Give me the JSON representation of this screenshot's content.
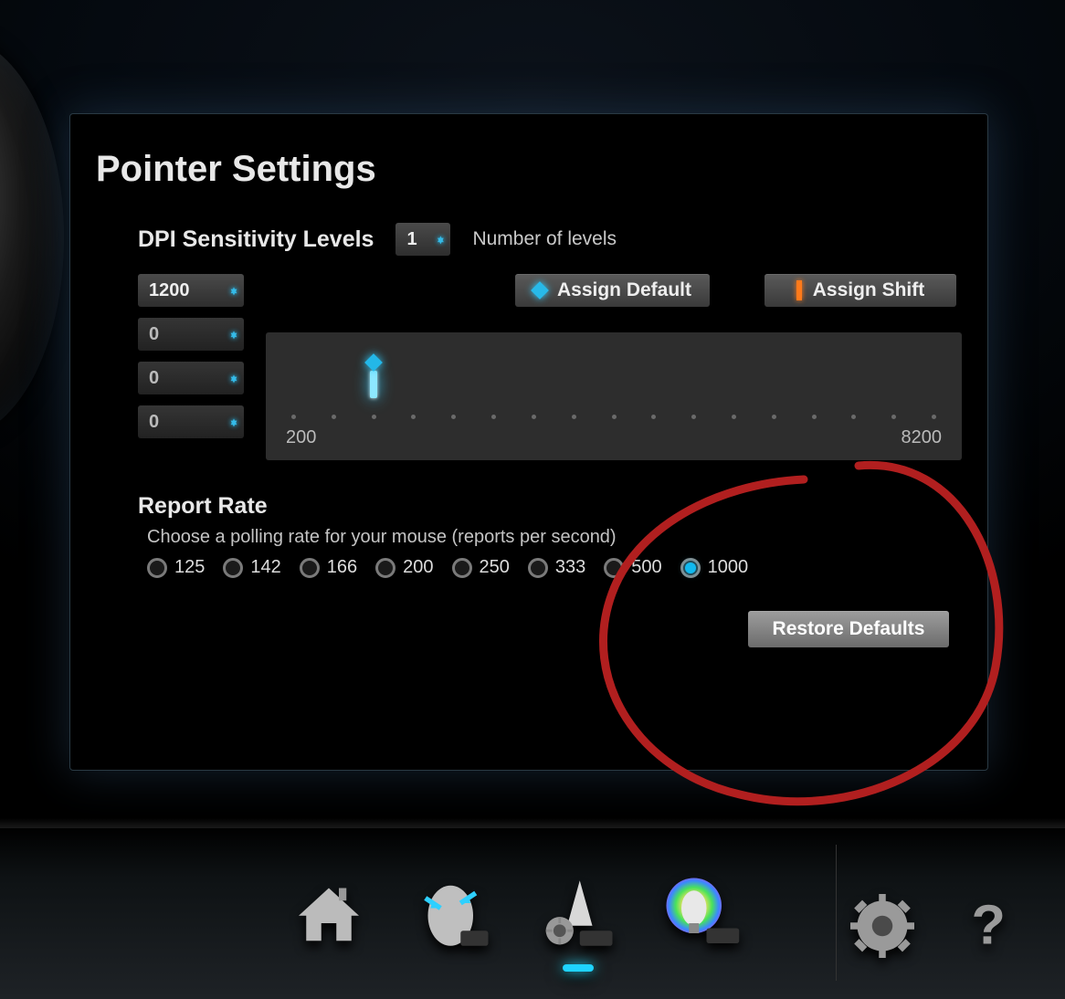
{
  "panel": {
    "title": "Pointer Settings",
    "dpi_label": "DPI Sensitivity Levels",
    "levels_stepper_value": "1",
    "levels_caption": "Number of levels",
    "assign_default_label": "Assign Default",
    "assign_shift_label": "Assign Shift",
    "dpi_values": [
      "1200",
      "0",
      "0",
      "0"
    ],
    "slider": {
      "min": "200",
      "max": "8200",
      "current": "1200"
    },
    "report_title": "Report Rate",
    "report_sub": "Choose a polling rate for your mouse (reports per second)",
    "report_options": [
      "125",
      "142",
      "166",
      "200",
      "250",
      "333",
      "500",
      "1000"
    ],
    "report_selected": "1000",
    "restore_label": "Restore Defaults"
  },
  "nav": {
    "items": [
      "home",
      "mouse",
      "pointer",
      "lighting"
    ],
    "selected": "pointer",
    "right_items": [
      "settings",
      "help"
    ]
  },
  "colors": {
    "accent": "#23b7e8",
    "orange": "#ff7a1a",
    "annotation": "#b11f1f"
  }
}
